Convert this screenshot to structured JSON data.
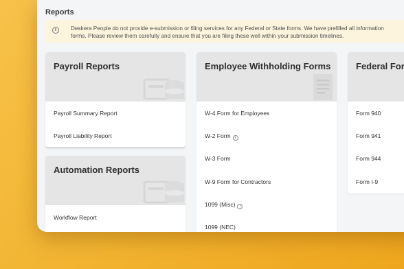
{
  "page": {
    "title": "Reports"
  },
  "notice": {
    "icon": "info-icon",
    "line1": "Deskera People do not provide e-submission or filing services for any Federal or State forms. We have prefilled all information",
    "line2": "forms. Please review them carefully and ensure that you are filing these well within your submission timelines."
  },
  "cards": {
    "payroll": {
      "title": "Payroll Reports",
      "icon": "payroll-report-icon",
      "items": [
        "Payroll Summary Report",
        "Payroll Liability Report"
      ]
    },
    "automation": {
      "title": "Automation Reports",
      "icon": "automation-report-icon",
      "items": [
        "Workflow Report"
      ]
    },
    "withholding": {
      "title": "Employee Withholding Forms",
      "icon": "document-icon",
      "items": [
        "W-4 Form for Employees",
        "W-2 Form",
        "W-3 Form",
        "W-9 Form for Contractors",
        "1099 (Misc)",
        "1099 (NEC)"
      ]
    },
    "federal": {
      "title": "Federal Forms",
      "items": [
        "Form 940",
        "Form 941",
        "Form 944",
        "Form I-9"
      ]
    }
  }
}
